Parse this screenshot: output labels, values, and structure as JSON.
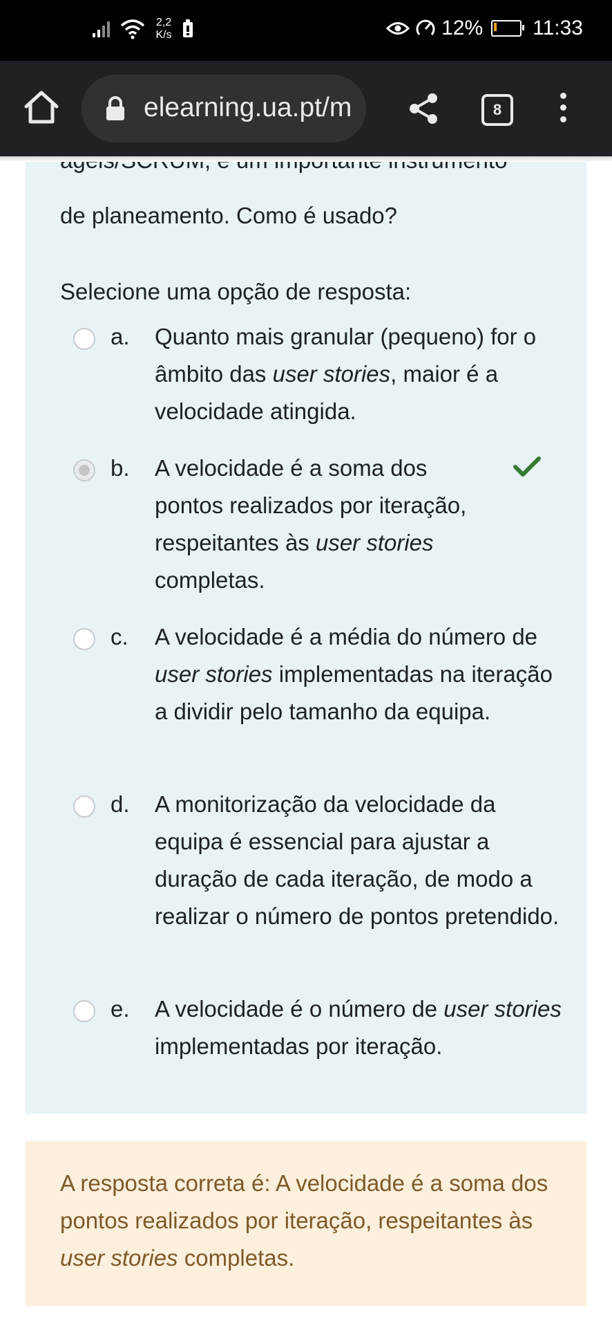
{
  "status_bar": {
    "net_speed_value": "2,2",
    "net_speed_unit": "K/s",
    "battery": "12%",
    "battery_level": 0.12,
    "time": "11:33"
  },
  "browser": {
    "url": "elearning.ua.pt/m",
    "tab_count": "8"
  },
  "question": {
    "text_cutoff": "ágeis/SCRUM, é um importante instrumento",
    "text": "de planeamento. Como é usado?",
    "prompt": "Selecione uma opção de resposta:",
    "options": [
      {
        "letter": "a.",
        "parts": [
          "Quanto mais granular (pequeno) for o âmbito das ",
          "user stories",
          ", maior é a velocidade atingida."
        ],
        "selected": false
      },
      {
        "letter": "b.",
        "parts": [
          "A velocidade é a soma dos pontos realizados por iteração, respeitantes às ",
          "user stories",
          " completas."
        ],
        "selected": true,
        "correct": true
      },
      {
        "letter": "c.",
        "parts": [
          "A velocidade é a média do número de ",
          "user stories",
          " implementadas na iteração a dividir pelo tamanho da equipa."
        ],
        "selected": false
      },
      {
        "letter": "d.",
        "parts": [
          "A monitorização da velocidade da equipa é essencial para ajustar a duração de cada iteração, de modo a realizar o número de pontos pretendido.",
          "",
          ""
        ],
        "selected": false
      },
      {
        "letter": "e.",
        "parts": [
          "A velocidade é o número de ",
          "user stories",
          " implementadas por iteração."
        ],
        "selected": false
      }
    ]
  },
  "feedback": {
    "parts": [
      "A resposta correta é: A velocidade é a soma dos pontos realizados por iteração, respeitantes às ",
      "user stories",
      " completas."
    ]
  },
  "colors": {
    "question_bg": "#e7f3f5",
    "feedback_bg": "#fcefdc",
    "feedback_text": "#7d5a29",
    "correct_check": "#357a32",
    "battery_low": "#f7a21b"
  }
}
